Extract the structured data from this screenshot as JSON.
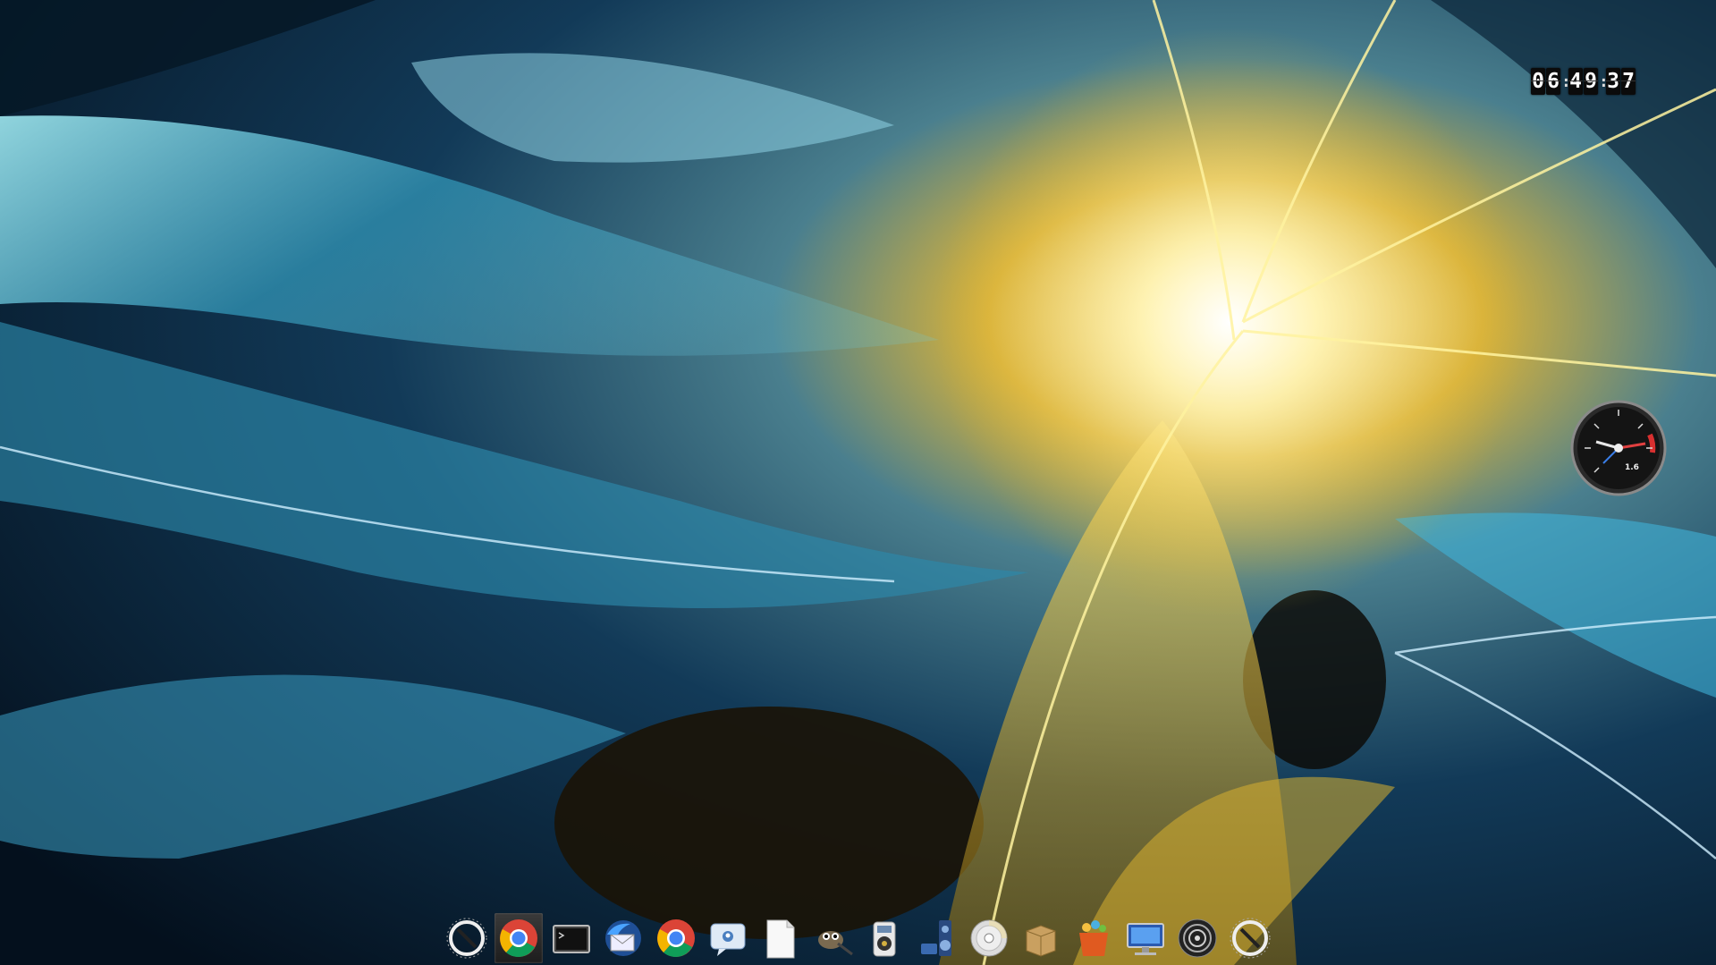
{
  "desktop": {
    "clock": {
      "hours": "06",
      "minutes": "49",
      "seconds": "37"
    },
    "gauge": {
      "value_label": "1.6",
      "name": "system-load-gauge"
    }
  },
  "dock": {
    "items": [
      {
        "name": "dock-menu-icon",
        "icon": "launcher-ring-icon",
        "active": false
      },
      {
        "name": "dock-chrome-icon",
        "icon": "chrome-icon",
        "active": true
      },
      {
        "name": "dock-terminal-icon",
        "icon": "terminal-icon",
        "active": false
      },
      {
        "name": "dock-thunderbird-icon",
        "icon": "mail-client-icon",
        "active": false
      },
      {
        "name": "dock-chrome-2-icon",
        "icon": "chrome-icon",
        "active": false
      },
      {
        "name": "dock-chat-icon",
        "icon": "chat-bubble-icon",
        "active": false
      },
      {
        "name": "dock-document-icon",
        "icon": "blank-document-icon",
        "active": false
      },
      {
        "name": "dock-gimp-icon",
        "icon": "image-editor-icon",
        "active": false
      },
      {
        "name": "dock-media-player-icon",
        "icon": "music-player-icon",
        "active": false
      },
      {
        "name": "dock-audio-icon",
        "icon": "speakers-icon",
        "active": false
      },
      {
        "name": "dock-disc-icon",
        "icon": "cd-disc-icon",
        "active": false
      },
      {
        "name": "dock-archive-icon",
        "icon": "package-box-icon",
        "active": false
      },
      {
        "name": "dock-apps-bag-icon",
        "icon": "shopping-bag-icon",
        "active": false
      },
      {
        "name": "dock-network-icon",
        "icon": "computer-monitor-icon",
        "active": false
      },
      {
        "name": "dock-speaker-icon",
        "icon": "speaker-cone-icon",
        "active": false
      },
      {
        "name": "dock-menu-2-icon",
        "icon": "launcher-ring-icon",
        "active": false
      }
    ]
  },
  "colors": {
    "wallpaper_blue": "#1a6f96",
    "wallpaper_gold": "#f2d23a",
    "dock_active": "#2b2b2b"
  }
}
